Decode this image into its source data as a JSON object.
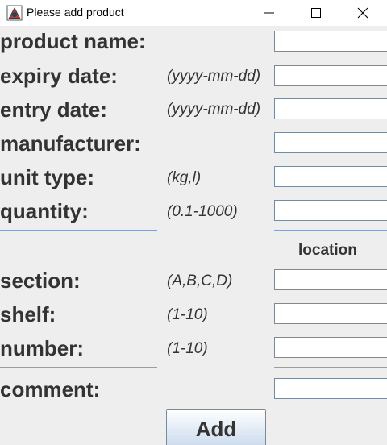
{
  "window": {
    "title": "Please add product",
    "icon": "java-app-icon",
    "minimize_icon": "minimize-icon",
    "maximize_icon": "maximize-icon",
    "close_icon": "close-icon"
  },
  "form": {
    "product_name": {
      "label": "product name:",
      "hint": "",
      "value": ""
    },
    "expiry_date": {
      "label": "expiry date:",
      "hint": "(yyyy-mm-dd)",
      "value": ""
    },
    "entry_date": {
      "label": "entry date:",
      "hint": "(yyyy-mm-dd)",
      "value": ""
    },
    "manufacturer": {
      "label": "manufacturer:",
      "hint": "",
      "value": ""
    },
    "unit_type": {
      "label": "unit type:",
      "hint": "(kg,l)",
      "value": ""
    },
    "quantity": {
      "label": "quantity:",
      "hint": "(0.1-1000)",
      "value": ""
    },
    "location_title": "location",
    "section": {
      "label": "section:",
      "hint": "(A,B,C,D)",
      "value": ""
    },
    "shelf": {
      "label": "shelf:",
      "hint": "(1-10)",
      "value": ""
    },
    "number": {
      "label": "number:",
      "hint": "(1-10)",
      "value": ""
    },
    "comment": {
      "label": "comment:",
      "hint": "",
      "value": ""
    },
    "add_button": "Add"
  },
  "colors": {
    "background": "#eeeeee",
    "label_text": "#333333",
    "separator": "#8aa0c0",
    "field_border": "#7a8a99",
    "button_gradient_bottom": "#c9d9ec"
  }
}
